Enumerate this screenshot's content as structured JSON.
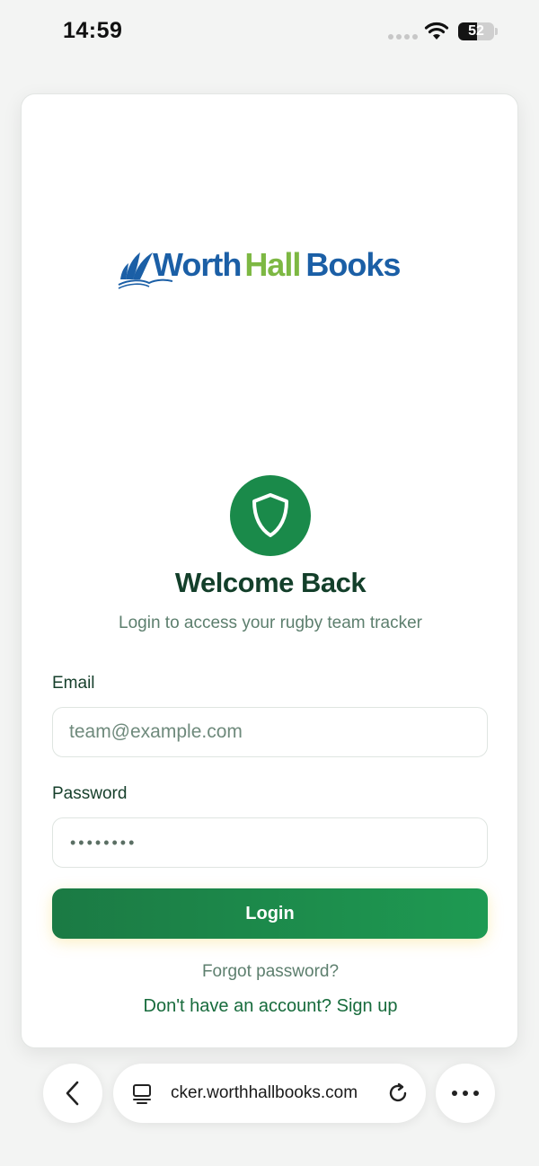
{
  "status_bar": {
    "time": "14:59",
    "battery": "52",
    "battery_level": 0.52
  },
  "brand": {
    "logo_part1": "Worth",
    "logo_part2": "Hall",
    "logo_part3": "Books",
    "colors": {
      "blue": "#1b5fa6",
      "green": "#7db843"
    }
  },
  "login": {
    "icon": "shield-icon",
    "title": "Welcome Back",
    "subtitle": "Login to access your rugby team tracker",
    "email_label": "Email",
    "email_placeholder": "team@example.com",
    "password_label": "Password",
    "password_masked": "••••••••",
    "login_button": "Login",
    "forgot_password": "Forgot password?",
    "signup_text": "Don't have an account? Sign up",
    "accent_color": "#1a8a4a"
  },
  "browser": {
    "url": "cker.worthhallbooks.com",
    "icons": [
      "back-chevron-icon",
      "tabs-icon",
      "reload-icon",
      "more-icon"
    ]
  }
}
